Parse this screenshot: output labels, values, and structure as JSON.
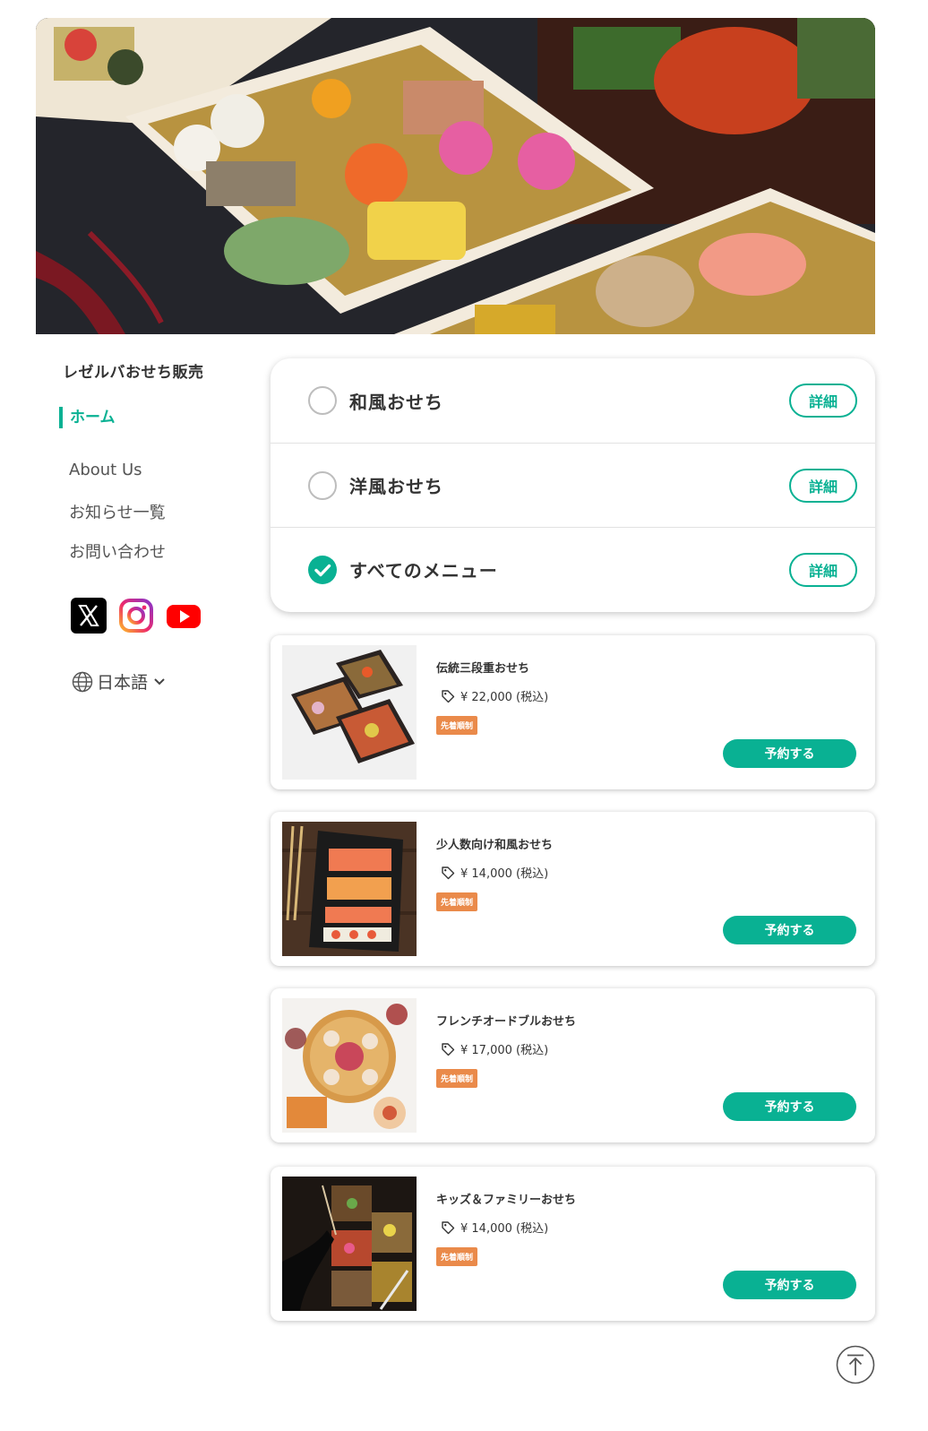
{
  "sidebar": {
    "shop_name": "レゼルバおせち販売",
    "nav_active": "ホーム",
    "nav_links": [
      "About Us",
      "お知らせ一覧",
      "お問い合わせ"
    ],
    "social": [
      "x-icon",
      "instagram-icon",
      "youtube-icon"
    ],
    "language": "日本語"
  },
  "categories": {
    "detail_label": "詳細",
    "items": [
      {
        "label": "和風おせち",
        "selected": false
      },
      {
        "label": "洋風おせち",
        "selected": false
      },
      {
        "label": "すべてのメニュー",
        "selected": true
      }
    ]
  },
  "products": [
    {
      "name": "伝統三段重おせち",
      "price": "¥ 22,000 (税込)",
      "badge": "先着順制",
      "button": "予約する"
    },
    {
      "name": "少人数向け和風おせち",
      "price": "¥ 14,000 (税込)",
      "badge": "先着順制",
      "button": "予約する"
    },
    {
      "name": "フレンチオードブルおせち",
      "price": "¥ 17,000 (税込)",
      "badge": "先着順制",
      "button": "予約する"
    },
    {
      "name": "キッズ＆ファミリーおせち",
      "price": "¥ 14,000 (税込)",
      "badge": "先着順制",
      "button": "予約する"
    }
  ],
  "colors": {
    "accent": "#09b193",
    "badge": "#ea8a4a",
    "text": "#333333"
  }
}
